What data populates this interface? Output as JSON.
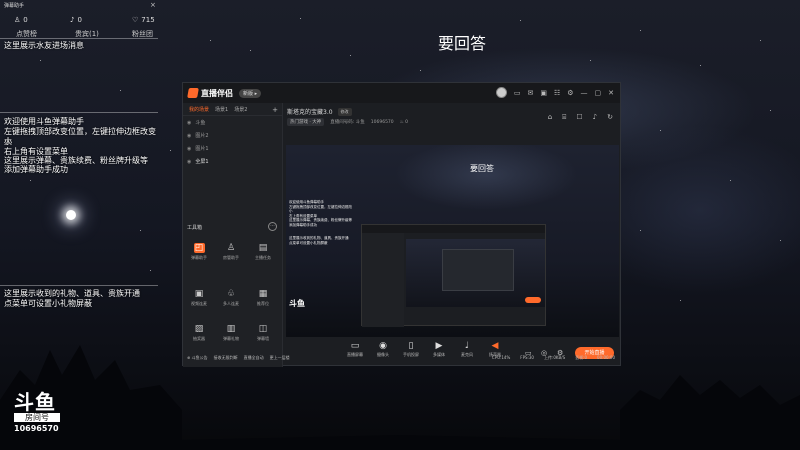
{
  "danmu": {
    "title": "弹幕助手",
    "close": "×",
    "stats": [
      {
        "icon": "person-icon",
        "glyph": "♙",
        "value": "0",
        "label": "点赞榜"
      },
      {
        "icon": "bell-icon",
        "glyph": "♪",
        "value": "0",
        "label": "贵宾(1)"
      },
      {
        "icon": "heart-icon",
        "glyph": "♡",
        "value": "715",
        "label": "粉丝团"
      }
    ],
    "enter_msg": "这里展示水友进场消息",
    "tips": [
      "欢迎使用斗鱼弹幕助手",
      "左键拖拽顶部改变位置，左键拉伸边框改变大",
      "小",
      "右上角有设置菜单",
      "这里展示弹幕、贵族续费、粉丝牌升级等",
      "添加弹幕助手成功"
    ],
    "gift_msgs": [
      "这里展示收到的礼物、道具、贵族开通",
      "点菜单可设置小礼物屏蔽"
    ]
  },
  "overlay_answer": "要回答",
  "app": {
    "title": "直播伴侣",
    "version_badge": "新版 ▸",
    "window_icons": [
      "▭",
      "✉",
      "▣",
      "☷",
      "⚙",
      "—",
      "▢",
      "✕"
    ],
    "sidebar": {
      "tabs": [
        "我的场景",
        "场景1",
        "场景2"
      ],
      "add": "+",
      "scenes": [
        {
          "label": "斗鱼",
          "on": false
        },
        {
          "label": "图片2",
          "on": false
        },
        {
          "label": "图片1",
          "on": false
        },
        {
          "label": "全屏1",
          "on": true
        }
      ],
      "tools_label": "工具箱",
      "tools_more": "···",
      "tools": [
        {
          "icon": "danmu-icon",
          "glyph": "◰",
          "label": "弹幕助手",
          "selected": true
        },
        {
          "icon": "users-icon",
          "glyph": "♙",
          "label": "房管助手",
          "selected": false
        },
        {
          "icon": "task-icon",
          "glyph": "▤",
          "label": "主播任务",
          "selected": false
        },
        {
          "icon": "video-icon",
          "glyph": "▣",
          "label": "视频连麦",
          "selected": false
        },
        {
          "icon": "game-icon",
          "glyph": "♧",
          "label": "多人连麦",
          "selected": false
        },
        {
          "icon": "vote-icon",
          "glyph": "▦",
          "label": "推荐位",
          "selected": false
        },
        {
          "icon": "draw-icon",
          "glyph": "▨",
          "label": "抽奖器",
          "selected": false
        },
        {
          "icon": "scene-icon",
          "glyph": "▥",
          "label": "弹幕礼物",
          "selected": false
        },
        {
          "icon": "screen-icon",
          "glyph": "◫",
          "label": "弹幕墙",
          "selected": false
        }
      ]
    },
    "room": {
      "name": "斯塔克的宝藏3.0",
      "tag": "修改",
      "category": "热门游戏 · 大神",
      "rid_label": "直播间号码: 斗鱼",
      "rid": "10696570",
      "viewers": "♨ 0"
    },
    "content_icons": [
      "⌂",
      "⌸",
      "☐",
      "♪",
      "↻"
    ],
    "preview": {
      "answer": "要回答",
      "msgs": [
        "欢迎使用斗鱼弹幕助手",
        "左键拖拽顶部改变位置，左键拉伸边框改",
        "小",
        "右上角有设置菜单",
        "这里展示弹幕、贵族续费、粉丝牌升级等",
        "添加弹幕助手成功",
        "",
        "",
        "这里展示收到的礼物、道具、贵族开通",
        "点菜单可设置小礼物屏蔽"
      ],
      "logo": "斗鱼"
    },
    "bottom_tools": [
      {
        "icon": "screen-share-icon",
        "glyph": "▭",
        "label": "直播屏幕"
      },
      {
        "icon": "camera-icon",
        "glyph": "◉",
        "label": "摄像头"
      },
      {
        "icon": "phone-icon",
        "glyph": "▯",
        "label": "手机投屏"
      },
      {
        "icon": "media-icon",
        "glyph": "▶",
        "label": "多媒体"
      },
      {
        "icon": "mic-icon",
        "glyph": "♩",
        "label": "麦克风"
      },
      {
        "icon": "speaker-icon",
        "glyph": "◀",
        "label": "扬声器"
      }
    ],
    "live_icons": [
      "▭",
      "◎",
      "⚙"
    ],
    "go_live": "开始直播",
    "status": {
      "items": [
        "⊕ 斗鱼公告",
        "接收无限判断",
        "直播全自动",
        "更上一层楼"
      ],
      "right": [
        "CPU:14%",
        "FPS:30",
        "上传:0KB/S",
        "丢帧:0",
        "00:00:00"
      ]
    }
  },
  "bottom_logo": {
    "mark": "斗鱼",
    "sub": "房间号",
    "room": "10696570"
  }
}
